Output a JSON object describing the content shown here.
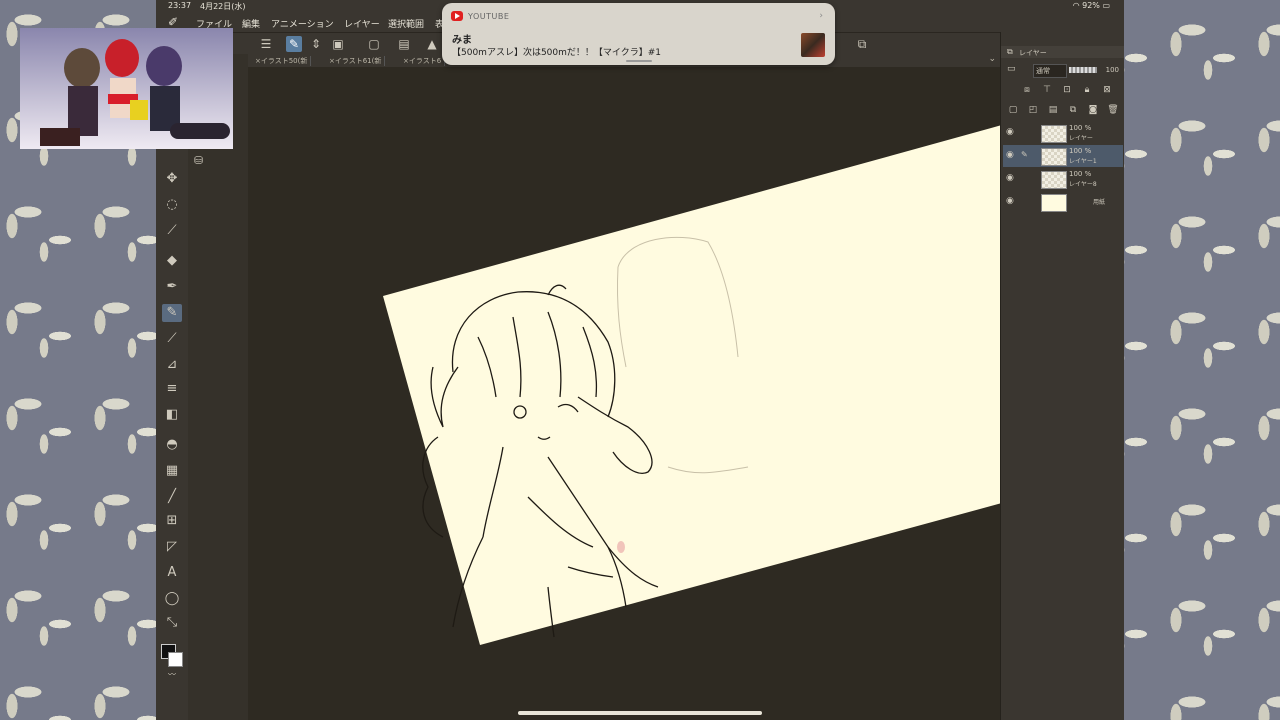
{
  "status_bar": {
    "time": "23:37",
    "date": "4月22日(水)",
    "right": "92%"
  },
  "menu": {
    "items": [
      "ファイル",
      "編集",
      "アニメーション",
      "レイヤー",
      "選択範囲",
      "表"
    ]
  },
  "tabs": [
    "×イラスト50(新",
    "×イラスト61(新",
    "×イラスト6"
  ],
  "notification": {
    "app": "YOUTUBE",
    "sender": "みま",
    "message": "【500mアスレ】次は500mだ！！【マイクラ】#1"
  },
  "layer_panel": {
    "title": "レイヤー",
    "blend_mode": "通常",
    "opacity": "100",
    "layers": [
      {
        "opacity": "100 %",
        "name": "レイヤー",
        "kind": "raster",
        "selected": false
      },
      {
        "opacity": "100 %",
        "name": "レイヤー1",
        "kind": "raster",
        "selected": true
      },
      {
        "opacity": "100 %",
        "name": "レイヤー8",
        "kind": "raster",
        "selected": false
      },
      {
        "opacity": "",
        "name": "用紙",
        "kind": "paper",
        "selected": false
      }
    ]
  },
  "icons": {
    "tools": [
      "move-icon",
      "lasso-icon",
      "eyedropper-icon",
      "fill-icon",
      "pen-icon",
      "pencil-icon",
      "brush-icon",
      "airbrush-icon",
      "decoration-icon",
      "eraser-icon",
      "blend-icon",
      "gradient-icon",
      "line-icon",
      "frame-icon",
      "ruler-icon",
      "text-icon",
      "balloon-icon",
      "correct-line-icon"
    ]
  },
  "colors": {
    "paper": "#fffbe0",
    "canvas_bg": "#2e2a22",
    "ui_bg": "#3a3630",
    "selection": "#4d5a6a"
  }
}
